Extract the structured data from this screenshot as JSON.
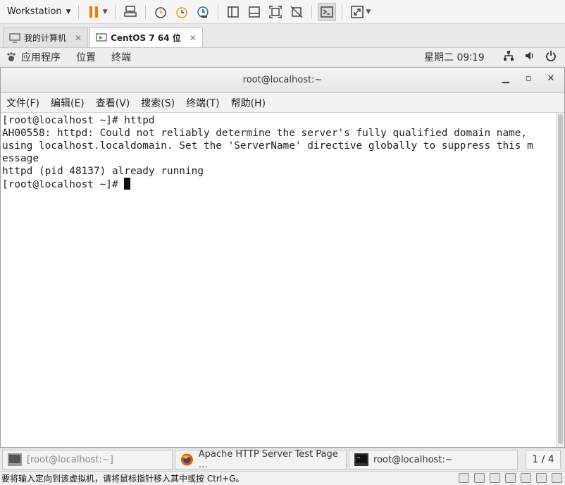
{
  "toolbar": {
    "workstation_label": "Workstation"
  },
  "vm_tabs": [
    {
      "label": "我的计算机",
      "active": false
    },
    {
      "label": "CentOS 7 64 位",
      "active": true
    }
  ],
  "gnome": {
    "apps": "应用程序",
    "places": "位置",
    "terminal": "终端",
    "clock": "星期二 09∶19"
  },
  "terminal": {
    "title": "root@localhost:~",
    "menu": [
      "文件(F)",
      "编辑(E)",
      "查看(V)",
      "搜索(S)",
      "终端(T)",
      "帮助(H)"
    ],
    "lines": [
      "[root@localhost ~]# httpd",
      "AH00558: httpd: Could not reliably determine the server's fully qualified domain name,",
      "using localhost.localdomain. Set the 'ServerName' directive globally to suppress this m",
      "essage",
      "httpd (pid 48137) already running"
    ],
    "prompt": "[root@localhost ~]# "
  },
  "taskbar": {
    "tasks": [
      {
        "label": "[root@localhost:~]"
      },
      {
        "label": "Apache HTTP Server Test Page …"
      },
      {
        "label": "root@localhost:~"
      }
    ],
    "pager": "1 / 4"
  },
  "status": {
    "text": "要将输入定向到该虚拟机，请将鼠标指针移入其中或按 Ctrl+G。"
  },
  "colors": {
    "pause": "#f07a00",
    "accent": "#e8a000"
  }
}
